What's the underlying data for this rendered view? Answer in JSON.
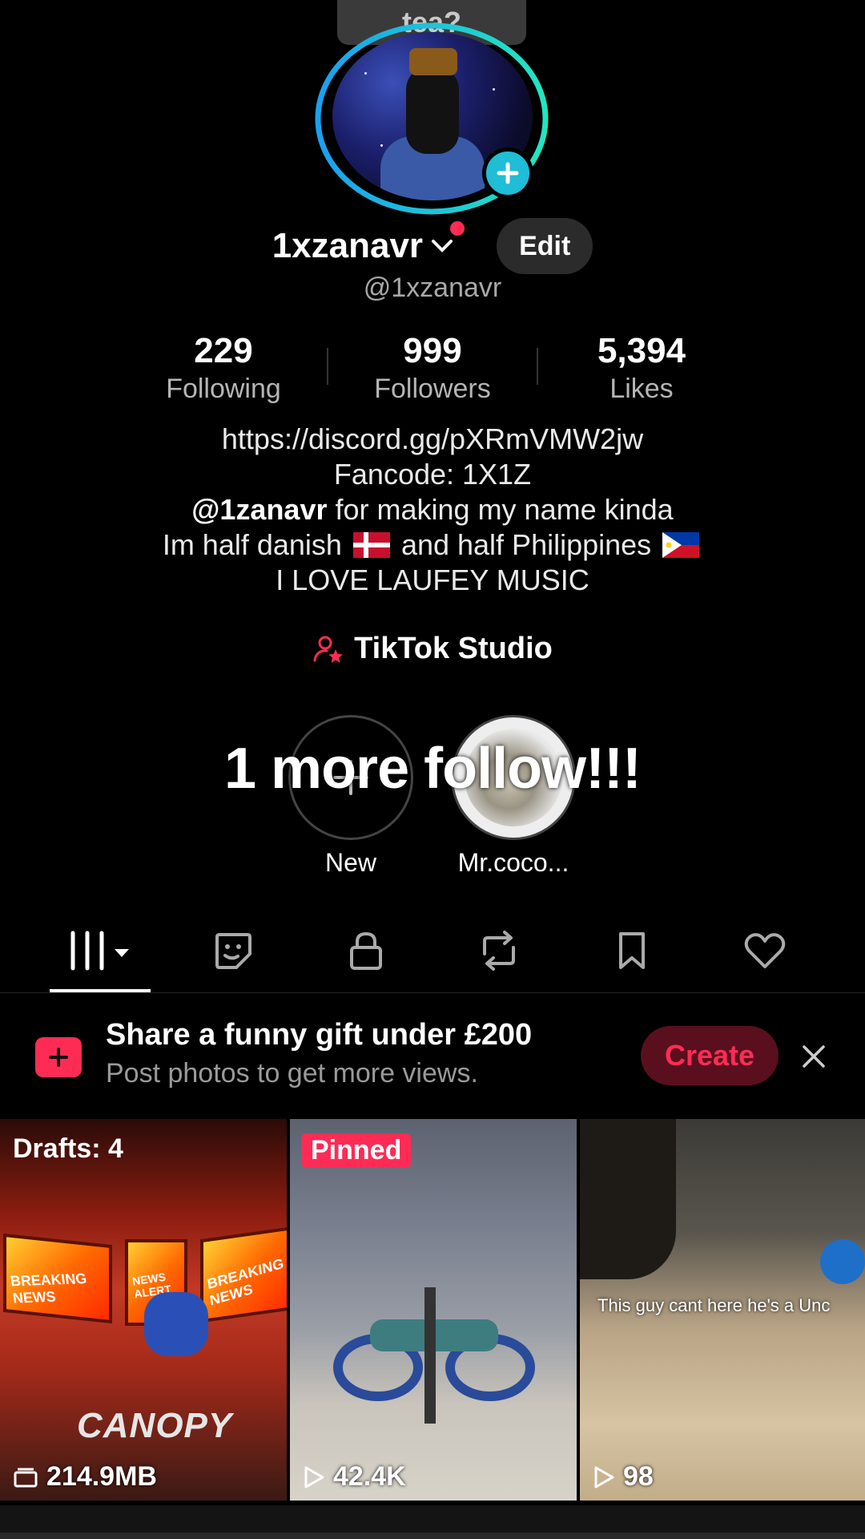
{
  "colors": {
    "accent": "#fe2c55",
    "cyan": "#20bdd6",
    "background": "#000000"
  },
  "top_bubble": {
    "text": "tea?"
  },
  "profile": {
    "display_name": "1xzanavr",
    "username": "@1xzanavr",
    "edit_label": "Edit"
  },
  "stats": [
    {
      "value": "229",
      "label": "Following"
    },
    {
      "value": "999",
      "label": "Followers"
    },
    {
      "value": "5,394",
      "label": "Likes"
    }
  ],
  "bio": {
    "line1": "https://discord.gg/pXRmVMW2jw",
    "line2": "Fancode: 1X1Z",
    "line3_mention": "@1zanavr",
    "line3_rest": " for making my name kinda",
    "line4_a": "Im half danish ",
    "line4_b": " and half Philippines ",
    "line5": "I LOVE LAUFEY MUSIC"
  },
  "studio": {
    "label": "TikTok Studio",
    "icon": "creator-star-icon"
  },
  "overlay_text": "1 more follow!!!",
  "stories": [
    {
      "label": "New",
      "icon": "plus-icon"
    },
    {
      "label": "Mr.coco..."
    }
  ],
  "tabs": [
    {
      "icon": "grid-videos-icon",
      "active": true
    },
    {
      "icon": "sticker-icon"
    },
    {
      "icon": "lock-icon"
    },
    {
      "icon": "repost-icon"
    },
    {
      "icon": "bookmark-icon"
    },
    {
      "icon": "heart-icon"
    }
  ],
  "banner": {
    "title": "Share a funny gift under £200",
    "subtitle": "Post photos to get more views.",
    "create_label": "Create"
  },
  "grid": [
    {
      "tag": "Drafts: 4",
      "stat": "214.9MB",
      "stat_icon": "drafts-icon",
      "scene_text": "CANOPY"
    },
    {
      "tag": "Pinned",
      "stat": "42.4K",
      "stat_icon": "play-icon"
    },
    {
      "caption": "This guy cant here he's a Unc",
      "stat": "98",
      "stat_icon": "play-icon"
    }
  ],
  "screens": [
    "BREAKING NEWS",
    "NEWS ALERT",
    "BREAKING NEWS"
  ]
}
